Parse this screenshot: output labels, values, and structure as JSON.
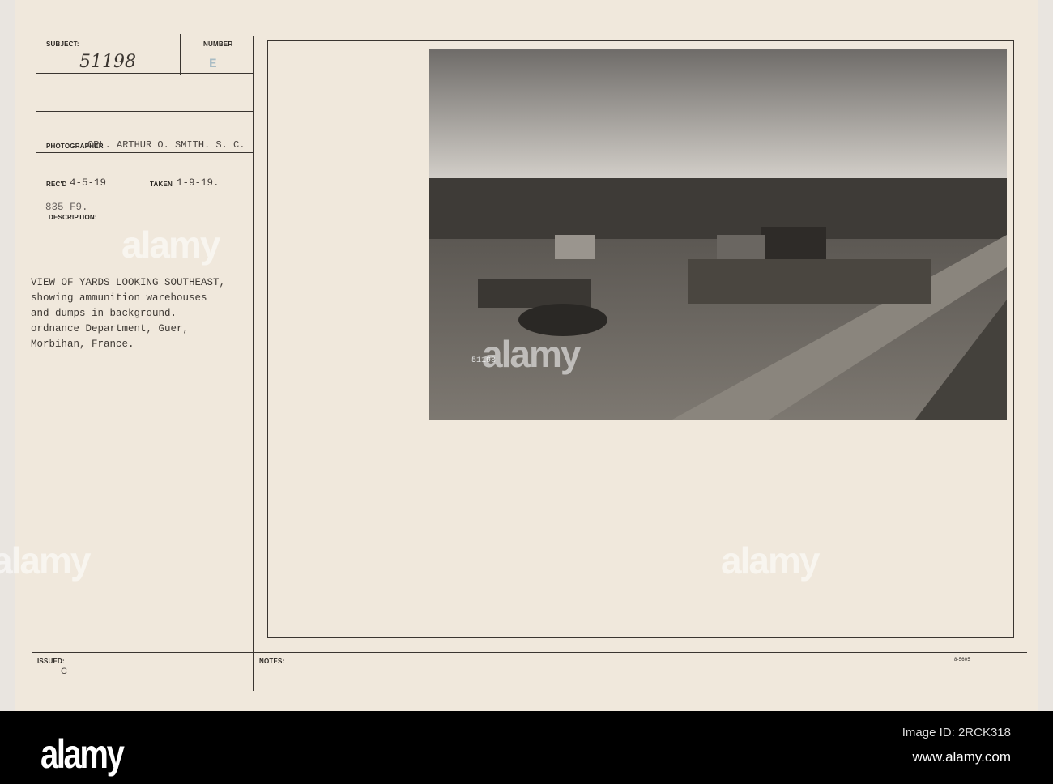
{
  "card": {
    "subject_label": "SUBJECT:",
    "subject_value": "51198",
    "number_label": "NUMBER",
    "number_value": "E",
    "photographer_label": "PHOTOGRAPHER",
    "photographer_value": "CPL. ARTHUR O. SMITH. S. C.",
    "recd_label": "REC'D",
    "recd_value": "4-5-19",
    "taken_label": "TAKEN",
    "taken_value": "1-9-19.",
    "file_code": "835-F9.",
    "description_label": "DESCRIPTION:",
    "description_lines": [
      "VIEW OF YARDS LOOKING SOUTHEAST,",
      "showing ammunition warehouses",
      "and dumps in background.",
      "ordnance Department, Guer,",
      "Morbihan, France."
    ],
    "issued_label": "ISSUED:",
    "issued_value": "C",
    "notes_label": "NOTES:",
    "form_number": "8-5605",
    "photo_number": "51198"
  },
  "watermark": "alamy",
  "footer": {
    "logo": "alamy",
    "image_id": "Image ID: 2RCK318",
    "url": "www.alamy.com"
  }
}
